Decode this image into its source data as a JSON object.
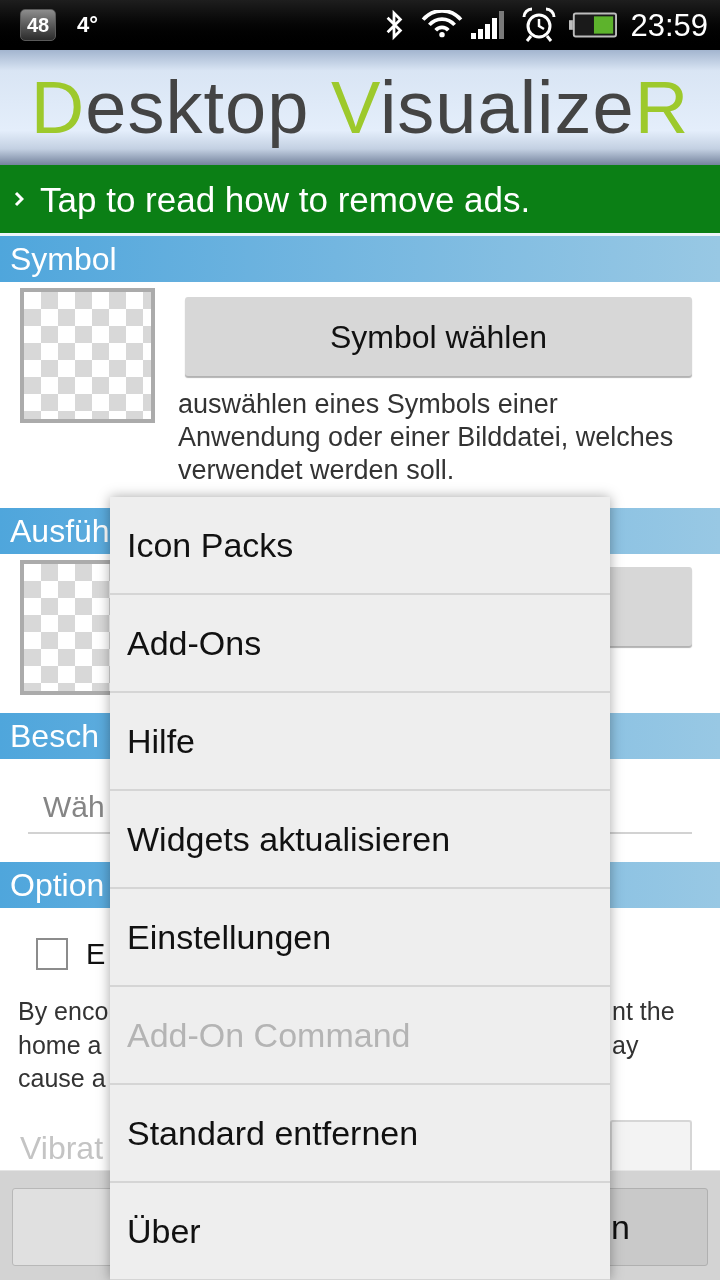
{
  "status_bar": {
    "notification_badge": "48",
    "temperature": "4°",
    "time": "23:59"
  },
  "header": {
    "logo": [
      {
        "text": "D",
        "accent": true
      },
      {
        "text": "esktop ",
        "accent": false
      },
      {
        "text": "V",
        "accent": true
      },
      {
        "text": "isualize",
        "accent": false
      },
      {
        "text": "R",
        "accent": true
      }
    ]
  },
  "ad_banner": {
    "text": "Tap to read how to remove ads."
  },
  "sections": [
    {
      "kind": "picker",
      "title": "Symbol",
      "button": "Symbol wählen",
      "description": "auswählen eines Symbols einer Anwendung oder einer Bilddatei, welches verwendet werden soll."
    },
    {
      "kind": "picker",
      "title": "Ausfüh"
    },
    {
      "kind": "field",
      "title": "Besch",
      "placeholder": "Wäh"
    },
    {
      "kind": "options",
      "title": "Option",
      "checkbox": {
        "label": "E",
        "checked": false
      },
      "description_left": [
        "By enco",
        "home a",
        "cause a"
      ],
      "description_right": [
        "nt the",
        "ay"
      ],
      "setting_label": "Vibrat"
    }
  ],
  "bottom_bar": {
    "buttons": [
      {
        "kind": "left"
      },
      {
        "kind": "right",
        "label": "n"
      }
    ]
  },
  "menu": {
    "items": [
      {
        "label": "Icon Packs",
        "disabled": false
      },
      {
        "label": "Add-Ons",
        "disabled": false
      },
      {
        "label": "Hilfe",
        "disabled": false
      },
      {
        "label": "Widgets aktualisieren",
        "disabled": false
      },
      {
        "label": "Einstellungen",
        "disabled": false
      },
      {
        "label": "Add-On Command",
        "disabled": true
      },
      {
        "label": "Standard entfernen",
        "disabled": false
      },
      {
        "label": "Über",
        "disabled": false
      }
    ]
  }
}
